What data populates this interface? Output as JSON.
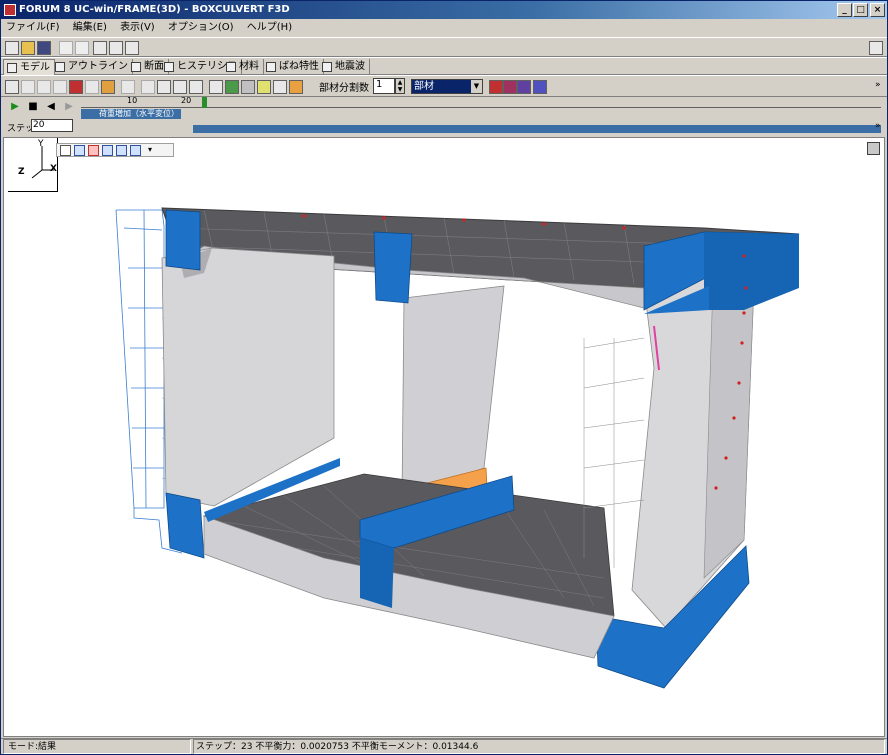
{
  "window": {
    "title": "FORUM 8  UC-win/FRAME(3D) - BOXCULVERT F3D",
    "controls": [
      "_",
      "□",
      "×"
    ]
  },
  "menu": [
    "ファイル(F)",
    "編集(E)",
    "表示(V)",
    "オプション(O)",
    "ヘルプ(H)"
  ],
  "tabs": [
    "モデル",
    "アウトライン",
    "断面",
    "ヒステリシス",
    "材料",
    "ばね特性",
    "地震波"
  ],
  "toolbar3": {
    "division_label": "部材分割数 N",
    "division_value": "1",
    "select_value": "部材"
  },
  "timeline": {
    "tick_10": "10",
    "tick_20": "20",
    "track_label": "荷重増加（水平変位）",
    "step_label": "ステップ",
    "step_value": "20"
  },
  "view": {
    "axis_y": "Y",
    "axis_z": "Z",
    "axis_x": "X"
  },
  "status": {
    "left": "モード:結果",
    "right": "ステップ：23 不平衡力：0.0020753 不平衡モーメント：0.01344.6"
  },
  "colors": {
    "accent_blue": "#1d72c8",
    "highlight_orange": "#f5a04a",
    "concrete_gray": "#d6d6d8",
    "deck_dark": "#5a5a5e"
  }
}
